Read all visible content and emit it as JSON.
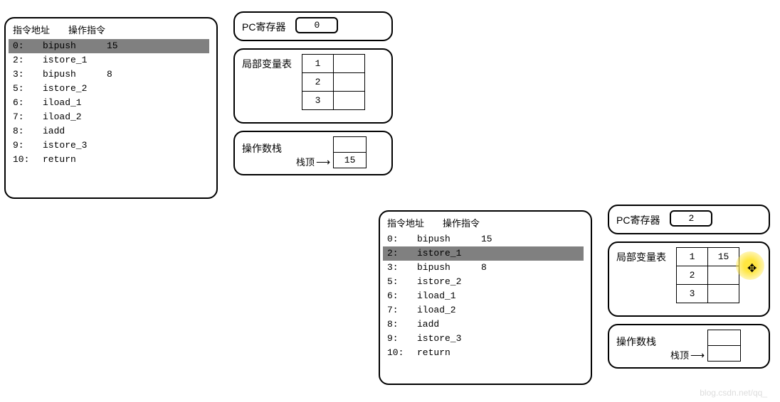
{
  "watermark": "blog.csdn.net/qq_",
  "headers": {
    "addr": "指令地址",
    "op": "操作指令"
  },
  "labels": {
    "pc": "PC寄存器",
    "lvt": "局部变量表",
    "opstack": "操作数栈",
    "stacktop": "栈顶"
  },
  "instructions": [
    {
      "addr": "0:",
      "op": "bipush",
      "arg": "15"
    },
    {
      "addr": "2:",
      "op": "istore_1",
      "arg": ""
    },
    {
      "addr": "3:",
      "op": "bipush",
      "arg": "8"
    },
    {
      "addr": "5:",
      "op": "istore_2",
      "arg": ""
    },
    {
      "addr": "6:",
      "op": "iload_1",
      "arg": ""
    },
    {
      "addr": "7:",
      "op": "iload_2",
      "arg": ""
    },
    {
      "addr": "8:",
      "op": "iadd",
      "arg": ""
    },
    {
      "addr": "9:",
      "op": "istore_3",
      "arg": ""
    },
    {
      "addr": "10:",
      "op": "return",
      "arg": ""
    }
  ],
  "state_a": {
    "pc": "0",
    "highlight_idx": 0,
    "lvt": [
      {
        "slot": "1",
        "val": ""
      },
      {
        "slot": "2",
        "val": ""
      },
      {
        "slot": "3",
        "val": ""
      }
    ],
    "stack": {
      "top": "15",
      "upper": ""
    }
  },
  "state_b": {
    "pc": "2",
    "highlight_idx": 1,
    "lvt": [
      {
        "slot": "1",
        "val": "15"
      },
      {
        "slot": "2",
        "val": ""
      },
      {
        "slot": "3",
        "val": ""
      }
    ],
    "stack": {
      "top": "",
      "upper": ""
    }
  }
}
